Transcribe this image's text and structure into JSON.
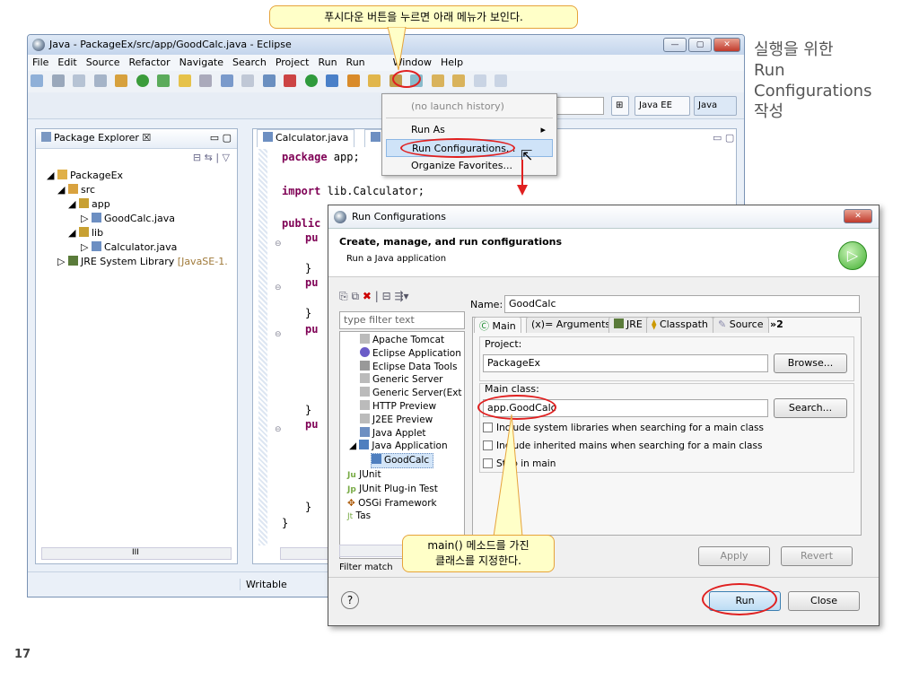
{
  "eclipse": {
    "title": "Java - PackageEx/src/app/GoodCalc.java - Eclipse",
    "menu": [
      "File",
      "Edit",
      "Source",
      "Refactor",
      "Navigate",
      "Search",
      "Project",
      "Run",
      "Run",
      "Window",
      "Help"
    ],
    "perspectives": [
      "Java EE",
      "Java"
    ],
    "status": "Writable"
  },
  "package_explorer": {
    "tab": "Package Explorer",
    "tab_badge": "☒",
    "tree": [
      {
        "label": "PackageEx"
      },
      {
        "label": "src"
      },
      {
        "label": "app"
      },
      {
        "label": "GoodCalc.java"
      },
      {
        "label": "lib"
      },
      {
        "label": "Calculator.java"
      },
      {
        "label": "JRE System Library",
        "extra": "[JavaSE-1."
      }
    ],
    "scroll_glyph": "III"
  },
  "editor": {
    "tab": "Calculator.java",
    "lines": [
      {
        "kw": "package",
        "rest": " app;"
      },
      {
        "kw": "import",
        "rest": " lib.Calculator;"
      },
      {
        "kw": "public",
        "rest": ""
      },
      {
        "kw": "",
        "rest": "pu"
      },
      {
        "kw": "",
        "rest": "}"
      },
      {
        "kw": "",
        "rest": "pu"
      },
      {
        "kw": "",
        "rest": "}"
      },
      {
        "kw": "",
        "rest": "pu"
      },
      {
        "kw": "",
        "rest": "}"
      },
      {
        "kw": "",
        "rest": "pu"
      },
      {
        "kw": "",
        "rest": "}"
      },
      {
        "kw": "",
        "rest": "}"
      }
    ]
  },
  "dropdown": {
    "items": [
      "(no launch history)",
      "Run As",
      "Run Configurations...",
      "Organize Favorites..."
    ]
  },
  "dialog": {
    "title": "Run Configurations",
    "header_title": "Create, manage, and run configurations",
    "header_sub": "Run a Java application",
    "filter_placeholder": "type filter text",
    "filter_matched": "Filter match",
    "tree": [
      "Apache Tomcat",
      "Eclipse Application",
      "Eclipse Data Tools",
      "Generic Server",
      "Generic Server(Ext",
      "HTTP Preview",
      "J2EE Preview",
      "Java Applet",
      "Java Application",
      "GoodCalc",
      "JUnit",
      "JUnit Plug-in Test",
      "OSGi Framework",
      "Tas"
    ],
    "name_label": "Name:",
    "name_value": "GoodCalc",
    "tabs": [
      "Main",
      "(x)= Arguments",
      "JRE",
      "Classpath",
      "Source",
      "»2"
    ],
    "project_label": "Project:",
    "project_value": "PackageEx",
    "browse": "Browse...",
    "main_class_label": "Main class:",
    "main_class_value": "app.GoodCalc",
    "search": "Search...",
    "checks": [
      "Include system libraries when searching for a main class",
      "Include inherited mains when searching for a main class",
      "Stop in main"
    ],
    "apply": "Apply",
    "revert": "Revert",
    "run": "Run",
    "close": "Close",
    "help": "?"
  },
  "annotations": {
    "top": "푸시다운 버튼을 누르면 아래 메뉴가 보인다.",
    "side": [
      "실행을 위한",
      "Run",
      "Configurations",
      "작성"
    ],
    "bottom": [
      "main() 메소드를 가진",
      "클래스를 지정한다."
    ]
  },
  "page_number": "17"
}
